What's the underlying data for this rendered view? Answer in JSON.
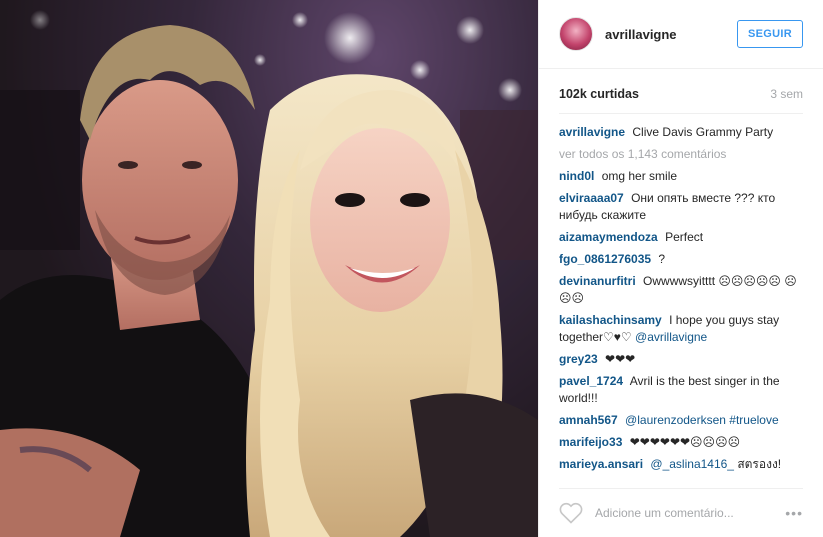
{
  "post": {
    "image_alt": "photo"
  },
  "header": {
    "username": "avrillavigne",
    "follow_label": "SEGUIR"
  },
  "stats": {
    "likes": "102k curtidas",
    "time": "3 sem"
  },
  "caption": {
    "user": "avrillavigne",
    "text": "Clive Davis Grammy Party"
  },
  "view_all": "ver todos os 1,143 comentários",
  "comments": [
    {
      "user": "nind0l",
      "text": "omg her smile",
      "mention": ""
    },
    {
      "user": "elviraaaa07",
      "text": "Они опять вместе ??? кто нибудь скажите",
      "mention": ""
    },
    {
      "user": "aizamaymendoza",
      "text": "Perfect",
      "mention": ""
    },
    {
      "user": "fgo_0861276035",
      "text": "?",
      "mention": ""
    },
    {
      "user": "devinanurfitri",
      "text": "Owwwwsyitttt ☹☹☹☹☹ ☹☹☹",
      "mention": ""
    },
    {
      "user": "kailashachinsamy",
      "text": "I hope you guys stay together♡♥♡ ",
      "mention": "@avrillavigne"
    },
    {
      "user": "grey23",
      "text": "❤❤❤",
      "mention": ""
    },
    {
      "user": "pavel_1724",
      "text": "Avril is the best singer in the world!!!",
      "mention": ""
    },
    {
      "user": "amnah567",
      "text": "",
      "mention": "@laurenzoderksen #truelove"
    },
    {
      "user": "marifeijo33",
      "text": "❤❤❤❤❤❤☹☹☹☹",
      "mention": ""
    },
    {
      "user": "marieya.ansari",
      "text": " สตรองง!",
      "mention": "@_aslina1416_"
    }
  ],
  "footer": {
    "placeholder": "Adicione um comentário...",
    "more": "•••"
  },
  "colors": {
    "link": "#125688",
    "follow": "#3897f0",
    "muted": "#a5a7aa"
  }
}
